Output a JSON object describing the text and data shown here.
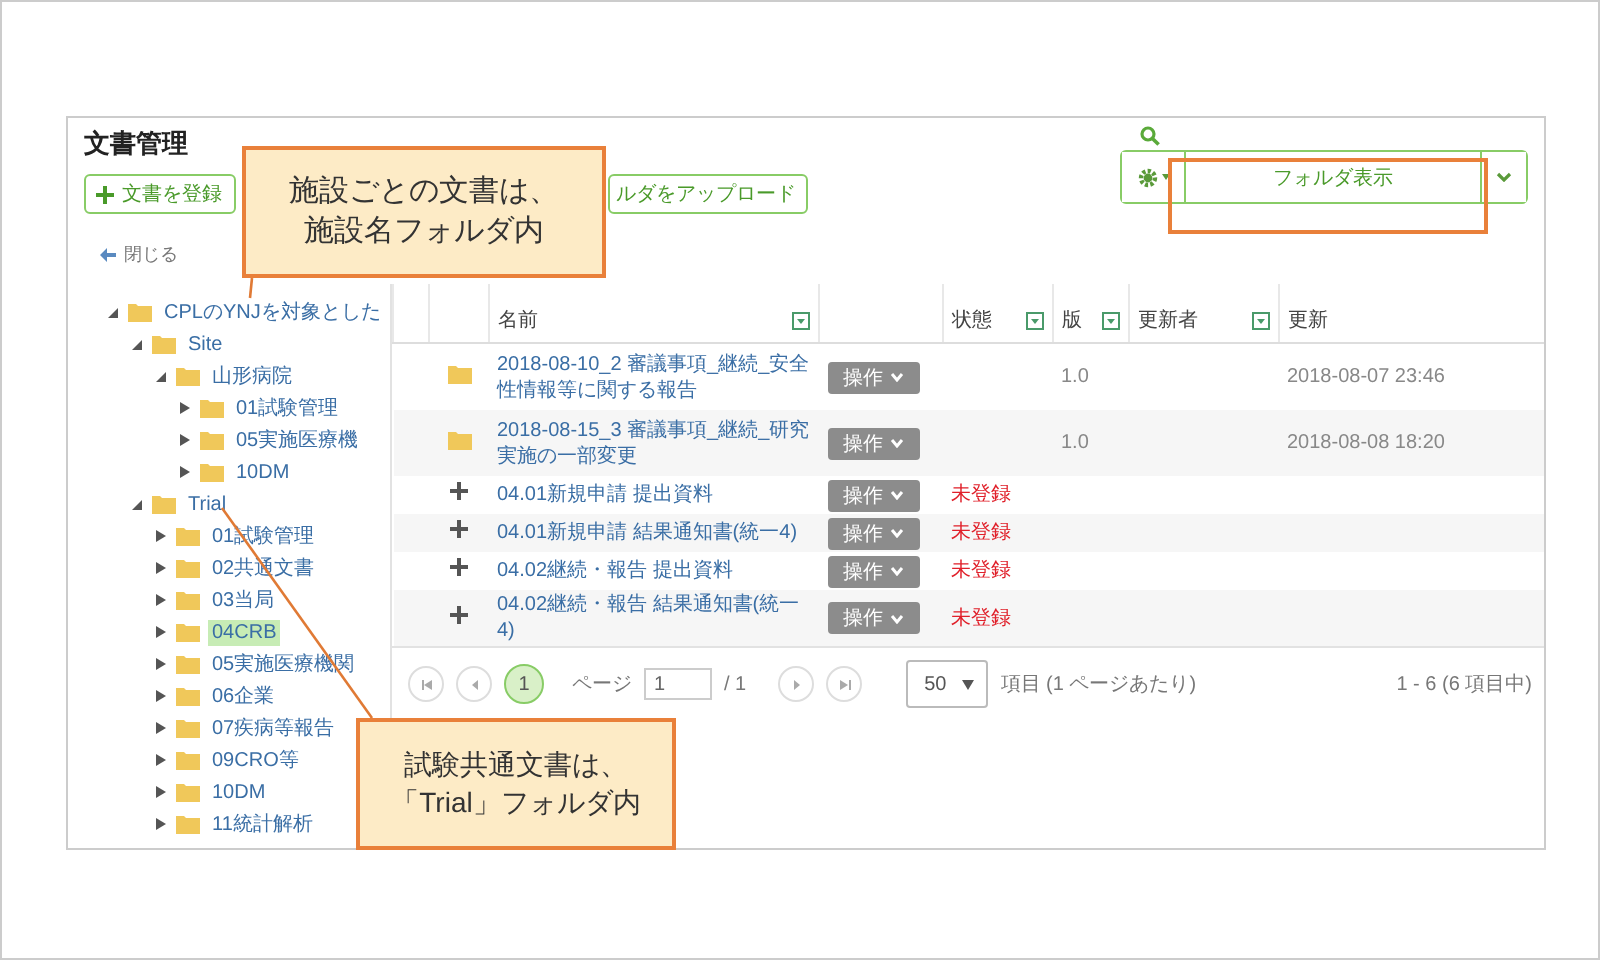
{
  "page": {
    "title": "文書管理"
  },
  "toolbar": {
    "buttons": [
      {
        "kind": "add",
        "label": "文書を登録"
      },
      {
        "kind": "upload",
        "label": "ルダをアップロード"
      }
    ],
    "view_button": {
      "label": "フォルダ表示"
    }
  },
  "close_link": {
    "label": "閉じる"
  },
  "tree": [
    {
      "label": "CPLのYNJを対象とした",
      "expanded": true,
      "selected": false,
      "children": [
        {
          "label": "Site",
          "expanded": true,
          "selected": false,
          "children": [
            {
              "label": "山形病院",
              "expanded": true,
              "selected": false,
              "children": [
                {
                  "label": "01試験管理",
                  "expanded": false,
                  "selected": false
                },
                {
                  "label": "05実施医療機",
                  "expanded": false,
                  "selected": false
                },
                {
                  "label": "10DM",
                  "expanded": false,
                  "selected": false
                }
              ]
            }
          ]
        },
        {
          "label": "Trial",
          "expanded": true,
          "selected": false,
          "children": [
            {
              "label": "01試験管理",
              "expanded": false,
              "selected": false
            },
            {
              "label": "02共通文書",
              "expanded": false,
              "selected": false
            },
            {
              "label": "03当局",
              "expanded": false,
              "selected": false
            },
            {
              "label": "04CRB",
              "expanded": false,
              "selected": true
            },
            {
              "label": "05実施医療機関",
              "expanded": false,
              "selected": false
            },
            {
              "label": "06企業",
              "expanded": false,
              "selected": false
            },
            {
              "label": "07疾病等報告",
              "expanded": false,
              "selected": false
            },
            {
              "label": "09CRO等",
              "expanded": false,
              "selected": false
            },
            {
              "label": "10DM",
              "expanded": false,
              "selected": false
            },
            {
              "label": "11統計解析",
              "expanded": false,
              "selected": false
            }
          ]
        }
      ]
    }
  ],
  "table": {
    "columns": [
      {
        "label": "名前",
        "filter": true
      },
      {
        "label": "状態",
        "filter": true
      },
      {
        "label": "版",
        "filter": true
      },
      {
        "label": "更新者",
        "filter": true
      },
      {
        "label": "更新",
        "filter": false
      }
    ],
    "rows": [
      {
        "kind": "folder",
        "name": "2018-08-10_2 審議事項_継続_安全性情報等に関する報告",
        "action": "操作",
        "version": "1.0",
        "updated": "2018-08-07 23:46"
      },
      {
        "kind": "folder",
        "name": "2018-08-15_3 審議事項_継続_研究実施の一部変更",
        "action": "操作",
        "version": "1.0",
        "updated": "2018-08-08 18:20"
      },
      {
        "kind": "new",
        "name": "04.01新規申請 提出資料",
        "action": "操作",
        "status": "未登録"
      },
      {
        "kind": "new",
        "name": "04.01新規申請 結果通知書(統一4)",
        "action": "操作",
        "status": "未登録"
      },
      {
        "kind": "new",
        "name": "04.02継続・報告 提出資料",
        "action": "操作",
        "status": "未登録"
      },
      {
        "kind": "new",
        "name": "04.02継続・報告 結果通知書(統一4)",
        "action": "操作",
        "status": "未登録"
      }
    ]
  },
  "pager": {
    "current_page": "1",
    "page_label": "ページ",
    "page_input": "1",
    "page_total": "/ 1",
    "page_size": "50",
    "per_page": "項目 (1 ページあたり)",
    "summary": "1 - 6 (6 項目中)"
  },
  "callouts": [
    {
      "lines": [
        "施設ごとの文書は、",
        "施設名フォルダ内"
      ]
    },
    {
      "lines": [
        "試験共通文書は、",
        "「Trial」フォルダ内"
      ]
    }
  ]
}
